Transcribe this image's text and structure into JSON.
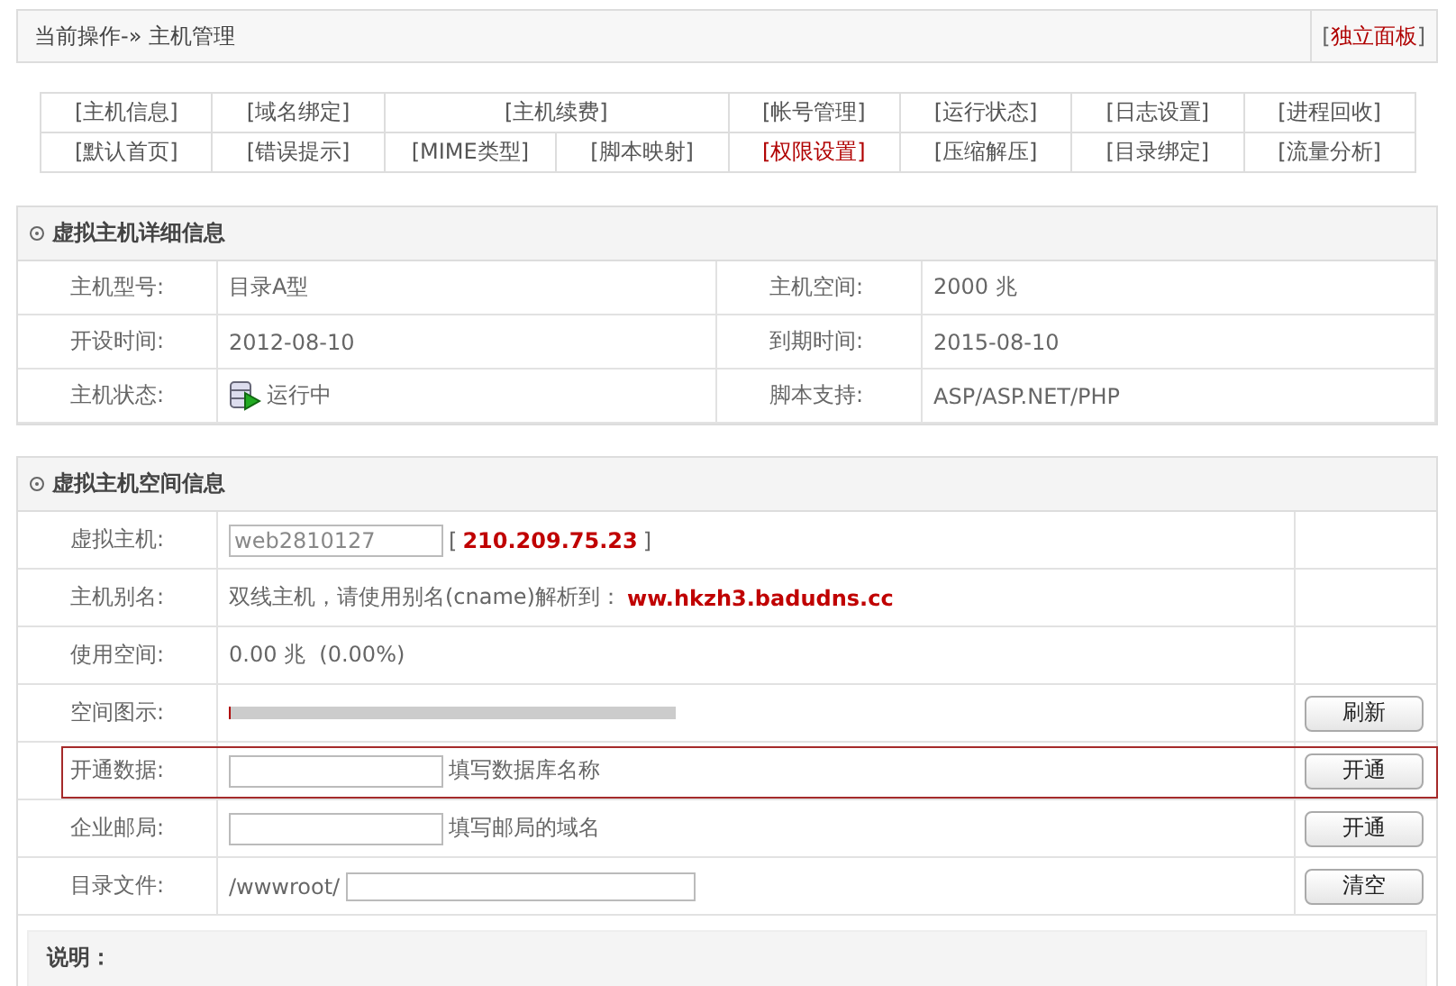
{
  "breadcrumb": {
    "prefix": "当前操作-»",
    "current": "主机管理"
  },
  "panel_link": {
    "open": "[",
    "label": "独立面板",
    "close": "]"
  },
  "nav_rows": [
    [
      {
        "kind": "normal",
        "label": "[主机信息]",
        "selected": false
      },
      {
        "kind": "normal",
        "label": "[域名绑定]",
        "selected": false
      },
      {
        "kind": "wide",
        "label": "[主机续费]",
        "selected": false
      },
      {
        "kind": "normal",
        "label": "[帐号管理]",
        "selected": false
      },
      {
        "kind": "normal",
        "label": "[运行状态]",
        "selected": false
      },
      {
        "kind": "normal",
        "label": "[日志设置]",
        "selected": false
      },
      {
        "kind": "normal",
        "label": "[进程回收]",
        "selected": false
      }
    ],
    [
      {
        "kind": "normal",
        "label": "[默认首页]",
        "selected": false
      },
      {
        "kind": "normal",
        "label": "[错误提示]",
        "selected": false
      },
      {
        "kind": "normal",
        "label": "[MIME类型]",
        "selected": false
      },
      {
        "kind": "normal",
        "label": "[脚本映射]",
        "selected": false
      },
      {
        "kind": "normal",
        "label": "[权限设置]",
        "selected": true
      },
      {
        "kind": "normal",
        "label": "[压缩解压]",
        "selected": false
      },
      {
        "kind": "normal",
        "label": "[目录绑定]",
        "selected": false
      },
      {
        "kind": "normal",
        "label": "[流量分析]",
        "selected": false
      }
    ]
  ],
  "detail": {
    "title": "虚拟主机详细信息",
    "rows": [
      {
        "label": "主机型号:",
        "value": "目录A型",
        "status_icon": false,
        "label_2": "主机空间:",
        "value_2": "2000 兆"
      },
      {
        "label": "开设时间:",
        "value": "2012-08-10",
        "status_icon": false,
        "label_2": "到期时间:",
        "value_2": "2015-08-10"
      },
      {
        "label": "主机状态:",
        "value": "运行中",
        "status_icon": true,
        "label_2": "脚本支持:",
        "value_2": "ASP/ASP.NET/PHP"
      }
    ]
  },
  "space": {
    "title": "虚拟主机空间信息",
    "rows": [
      {
        "kind": "host",
        "label": "虚拟主机:",
        "value": "web2810127",
        "open": "[",
        "ip": "210.209.75.23",
        "close": "]"
      },
      {
        "kind": "alias",
        "label": "主机别名:",
        "text": "双线主机，请使用别名(cname)解析到：",
        "domain": "ww.hkzh3.badudns.cc"
      },
      {
        "kind": "text",
        "label": "使用空间:",
        "text": "0.00 兆  (0.00%)"
      },
      {
        "kind": "meter",
        "label": "空间图示:",
        "level": 0.005,
        "button": "刷新"
      },
      {
        "kind": "input",
        "label": "开通数据:",
        "hint": "填写数据库名称",
        "button": "开通",
        "highlighted": true
      },
      {
        "kind": "input",
        "label": "企业邮局:",
        "hint": "填写邮局的域名",
        "button": "开通",
        "highlighted": false
      },
      {
        "kind": "path",
        "label": "目录文件:",
        "prefix": "/wwwroot/",
        "button": "清空"
      }
    ]
  },
  "note": {
    "title": "说明："
  }
}
